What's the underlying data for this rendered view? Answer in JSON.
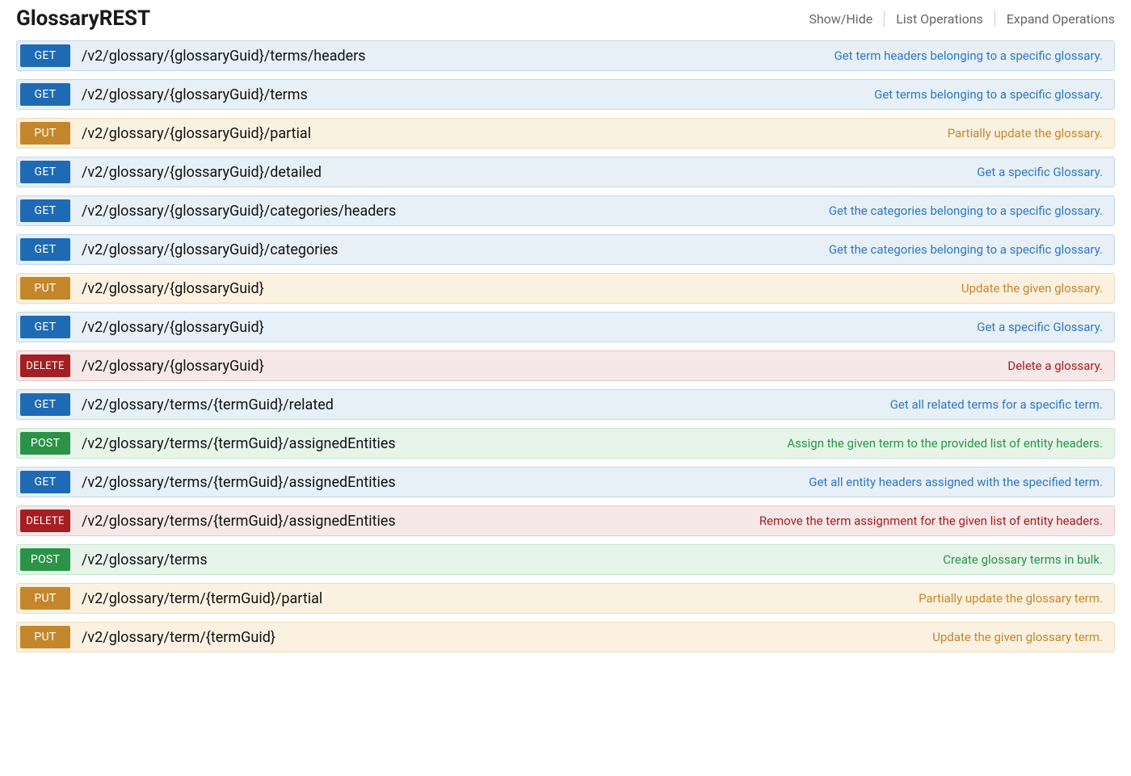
{
  "resource_title": "GlossaryREST",
  "header_links": {
    "show_hide": "Show/Hide",
    "list_ops": "List Operations",
    "expand_ops": "Expand Operations"
  },
  "operations": [
    {
      "method": "GET",
      "path": "/v2/glossary/{glossaryGuid}/terms/headers",
      "desc": "Get term headers belonging to a specific glossary."
    },
    {
      "method": "GET",
      "path": "/v2/glossary/{glossaryGuid}/terms",
      "desc": "Get terms belonging to a specific glossary."
    },
    {
      "method": "PUT",
      "path": "/v2/glossary/{glossaryGuid}/partial",
      "desc": "Partially update the glossary."
    },
    {
      "method": "GET",
      "path": "/v2/glossary/{glossaryGuid}/detailed",
      "desc": "Get a specific Glossary."
    },
    {
      "method": "GET",
      "path": "/v2/glossary/{glossaryGuid}/categories/headers",
      "desc": "Get the categories belonging to a specific glossary."
    },
    {
      "method": "GET",
      "path": "/v2/glossary/{glossaryGuid}/categories",
      "desc": "Get the categories belonging to a specific glossary."
    },
    {
      "method": "PUT",
      "path": "/v2/glossary/{glossaryGuid}",
      "desc": "Update the given glossary."
    },
    {
      "method": "GET",
      "path": "/v2/glossary/{glossaryGuid}",
      "desc": "Get a specific Glossary."
    },
    {
      "method": "DELETE",
      "path": "/v2/glossary/{glossaryGuid}",
      "desc": "Delete a glossary."
    },
    {
      "method": "GET",
      "path": "/v2/glossary/terms/{termGuid}/related",
      "desc": "Get all related terms for a specific term."
    },
    {
      "method": "POST",
      "path": "/v2/glossary/terms/{termGuid}/assignedEntities",
      "desc": "Assign the given term to the provided list of entity headers."
    },
    {
      "method": "GET",
      "path": "/v2/glossary/terms/{termGuid}/assignedEntities",
      "desc": "Get all entity headers assigned with the specified term."
    },
    {
      "method": "DELETE",
      "path": "/v2/glossary/terms/{termGuid}/assignedEntities",
      "desc": "Remove the term assignment for the given list of entity headers."
    },
    {
      "method": "POST",
      "path": "/v2/glossary/terms",
      "desc": "Create glossary terms in bulk."
    },
    {
      "method": "PUT",
      "path": "/v2/glossary/term/{termGuid}/partial",
      "desc": "Partially update the glossary term."
    },
    {
      "method": "PUT",
      "path": "/v2/glossary/term/{termGuid}",
      "desc": "Update the given glossary term."
    }
  ]
}
